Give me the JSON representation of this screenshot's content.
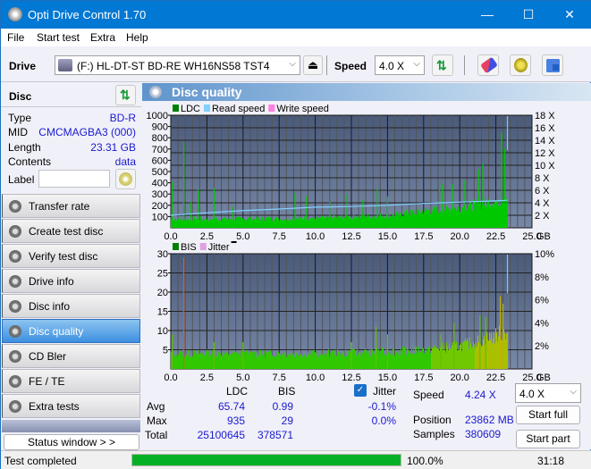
{
  "window": {
    "title": "Opti Drive Control 1.70",
    "minimize": "—",
    "maximize": "☐",
    "close": "✕"
  },
  "menu": [
    "File",
    "Start test",
    "Extra",
    "Help"
  ],
  "toolbar": {
    "drive_label": "Drive",
    "drive_value": "(F:)  HL-DT-ST BD-RE  WH16NS58 TST4",
    "speed_label": "Speed",
    "speed_value": "4.0 X"
  },
  "disc": {
    "header": "Disc",
    "rows": [
      {
        "k": "Type",
        "v": "BD-R"
      },
      {
        "k": "MID",
        "v": "CMCMAGBA3 (000)"
      },
      {
        "k": "Length",
        "v": "23.31 GB"
      },
      {
        "k": "Contents",
        "v": "data"
      }
    ],
    "label_key": "Label",
    "label_value": ""
  },
  "nav": [
    {
      "label": "Transfer rate",
      "active": false
    },
    {
      "label": "Create test disc",
      "active": false
    },
    {
      "label": "Verify test disc",
      "active": false
    },
    {
      "label": "Drive info",
      "active": false
    },
    {
      "label": "Disc info",
      "active": false
    },
    {
      "label": "Disc quality",
      "active": true
    },
    {
      "label": "CD Bler",
      "active": false
    },
    {
      "label": "FE / TE",
      "active": false
    },
    {
      "label": "Extra tests",
      "active": false
    }
  ],
  "status_window_btn": "Status window > >",
  "panel": {
    "title": "Disc quality"
  },
  "chart_data": [
    {
      "type": "bar",
      "title": "",
      "legend": [
        {
          "name": "LDC",
          "color": "#008000"
        },
        {
          "name": "Read speed",
          "color": "#80d0ff"
        },
        {
          "name": "Write speed",
          "color": "#ff80e0"
        }
      ],
      "legend_position": "top-left",
      "xlabel": "GB",
      "x_ticks": [
        "0.0",
        "2.5",
        "5.0",
        "7.5",
        "10.0",
        "12.5",
        "15.0",
        "17.5",
        "20.0",
        "22.5",
        "25.0"
      ],
      "xlim": [
        0,
        25
      ],
      "ylim": [
        0,
        1000
      ],
      "y_ticks": [
        "100",
        "200",
        "300",
        "400",
        "500",
        "600",
        "700",
        "800",
        "900",
        "1000"
      ],
      "y2_ticks": [
        "2 X",
        "4 X",
        "6 X",
        "8 X",
        "10 X",
        "12 X",
        "14 X",
        "16 X",
        "18 X"
      ],
      "y2lim": [
        0,
        18
      ],
      "grid": true,
      "ldc_baseline": [
        [
          0,
          80
        ],
        [
          5,
          80
        ],
        [
          10,
          85
        ],
        [
          15,
          110
        ],
        [
          17.5,
          150
        ],
        [
          20,
          180
        ],
        [
          22.5,
          240
        ],
        [
          23.3,
          280
        ]
      ],
      "ldc_spikes": [
        [
          0.1,
          410
        ],
        [
          0.9,
          760
        ],
        [
          1.4,
          230
        ],
        [
          1.9,
          340
        ],
        [
          3.0,
          350
        ],
        [
          4.3,
          190
        ],
        [
          8.6,
          310
        ],
        [
          9.4,
          280
        ],
        [
          11.0,
          230
        ],
        [
          12.2,
          300
        ],
        [
          13.3,
          250
        ],
        [
          14.3,
          350
        ],
        [
          15.0,
          280
        ],
        [
          18.6,
          420
        ],
        [
          18.8,
          380
        ],
        [
          19.5,
          390
        ],
        [
          20.3,
          420
        ],
        [
          21.3,
          520
        ],
        [
          21.6,
          570
        ],
        [
          22.9,
          850
        ],
        [
          23.1,
          700
        ]
      ],
      "read_speed": [
        [
          0,
          2.0
        ],
        [
          2.5,
          2.4
        ],
        [
          5,
          2.75
        ],
        [
          7.5,
          3.0
        ],
        [
          10,
          3.3
        ],
        [
          12.5,
          3.4
        ],
        [
          15,
          3.6
        ],
        [
          17.5,
          3.9
        ],
        [
          20,
          4.1
        ],
        [
          22.5,
          4.3
        ],
        [
          23.3,
          4.4
        ]
      ]
    },
    {
      "type": "bar",
      "title": "",
      "legend": [
        {
          "name": "BIS",
          "color": "#008000"
        },
        {
          "name": "Jitter",
          "color": "#e0a0e0"
        }
      ],
      "legend_position": "top-left",
      "xlabel": "GB",
      "x_ticks": [
        "0.0",
        "2.5",
        "5.0",
        "7.5",
        "10.0",
        "12.5",
        "15.0",
        "17.5",
        "20.0",
        "22.5",
        "25.0"
      ],
      "xlim": [
        0,
        25
      ],
      "ylim": [
        0,
        30
      ],
      "y_ticks": [
        "5",
        "10",
        "15",
        "20",
        "25",
        "30"
      ],
      "y2_ticks": [
        "2%",
        "4%",
        "6%",
        "8%",
        "10%"
      ],
      "y2lim": [
        0,
        10
      ],
      "grid": true,
      "bis_baseline": [
        [
          0,
          4
        ],
        [
          10,
          4
        ],
        [
          15,
          4.5
        ],
        [
          17.5,
          5
        ],
        [
          20,
          6
        ],
        [
          22,
          8
        ],
        [
          23.3,
          10
        ]
      ],
      "bis_spikes": [
        [
          0.1,
          9
        ],
        [
          0.9,
          29
        ],
        [
          3.0,
          7
        ],
        [
          5.0,
          7
        ],
        [
          12.5,
          7
        ],
        [
          14.2,
          11
        ],
        [
          15.0,
          9
        ],
        [
          18.7,
          9
        ],
        [
          19.6,
          12
        ],
        [
          21.4,
          14
        ],
        [
          21.8,
          13.5
        ],
        [
          22.8,
          19
        ],
        [
          23.0,
          17
        ]
      ]
    }
  ],
  "stats": {
    "col_ldc": "LDC",
    "col_bis": "BIS",
    "jitter_label": "Jitter",
    "jitter_checked": true,
    "rows": [
      {
        "label": "Avg",
        "ldc": "65.74",
        "bis": "0.99",
        "jitter": "-0.1%"
      },
      {
        "label": "Max",
        "ldc": "935",
        "bis": "29",
        "jitter": "0.0%"
      },
      {
        "label": "Total",
        "ldc": "25100645",
        "bis": "378571",
        "jitter": ""
      }
    ],
    "speed_label": "Speed",
    "speed_value": "4.24 X",
    "position_label": "Position",
    "position_value": "23862 MB",
    "samples_label": "Samples",
    "samples_value": "380609",
    "speed_select": "4.0 X",
    "start_full": "Start full",
    "start_part": "Start part"
  },
  "statusbar": {
    "text": "Test completed",
    "progress": 100.0,
    "progress_text": "100.0%",
    "time": "31:18"
  },
  "colors": {
    "accent": "#0078d4",
    "plot_bg_top": "#4a5a7a",
    "plot_bg_bottom": "#7888a8",
    "ldc_green": "#00c800",
    "read_speed": "#80d0ff",
    "progress": "#06b025"
  }
}
